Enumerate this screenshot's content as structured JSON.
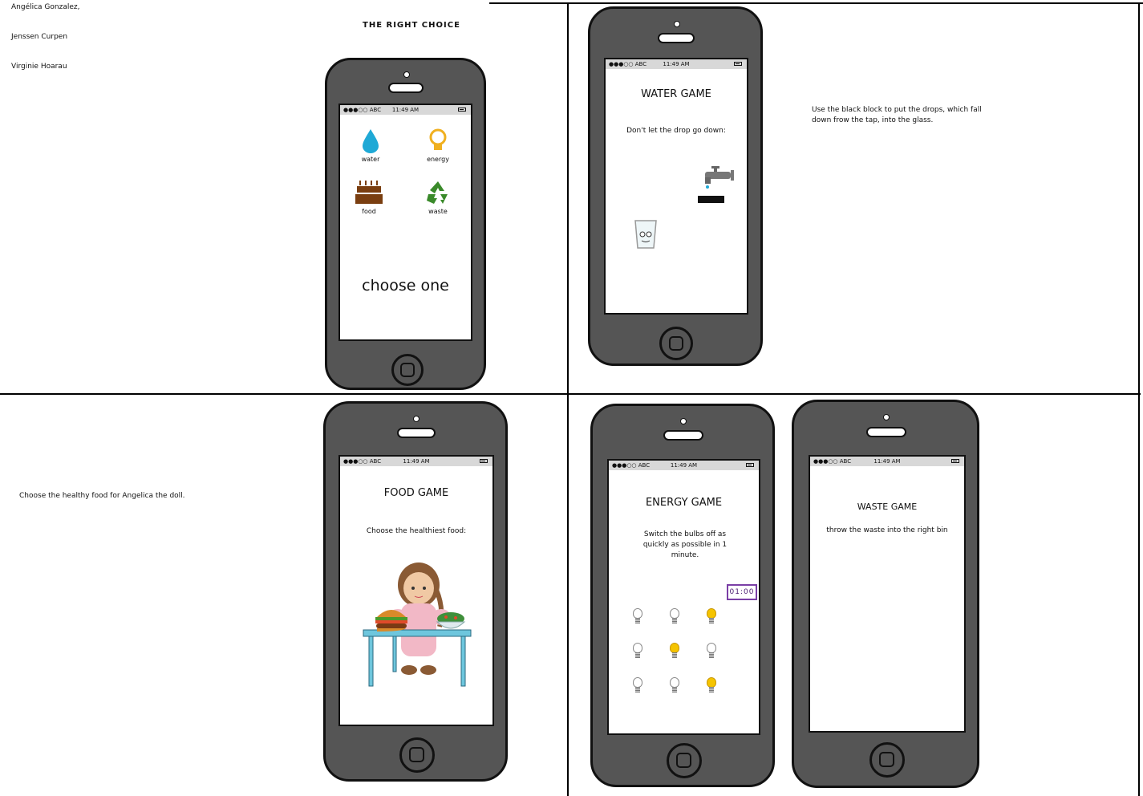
{
  "authors": [
    "Angélica Gonzalez,",
    "Jenssen Curpen",
    "Virginie Hoarau"
  ],
  "app_title": "THE RIGHT CHOICE",
  "status_bar": {
    "carrier": "●●●○○ ABC",
    "time": "11:49 AM"
  },
  "menu": {
    "categories": [
      {
        "label": "water",
        "icon": "water-drop-icon",
        "color": "#1fa9d6"
      },
      {
        "label": "energy",
        "icon": "lightbulb-icon",
        "color": "#f0b020"
      },
      {
        "label": "food",
        "icon": "cake-icon",
        "color": "#7a3e10"
      },
      {
        "label": "waste",
        "icon": "recycle-icon",
        "color": "#3a8a2a"
      }
    ],
    "prompt": "choose one"
  },
  "water_game": {
    "title": "WATER GAME",
    "instruction": "Don't let the drop go down:",
    "description": "Use the black block to put the drops, which fall down frow the tap,  into the glass."
  },
  "food_game": {
    "title": "FOOD GAME",
    "instruction": "Choose the healthiest food:",
    "description": "Choose the healthy food for Angelica the doll."
  },
  "energy_game": {
    "title": "ENERGY GAME",
    "instruction": "Switch the bulbs off as quickly as possible in 1 minute.",
    "timer": "01:00",
    "bulbs_on": [
      false,
      false,
      true,
      false,
      true,
      false,
      false,
      false,
      true
    ]
  },
  "waste_game": {
    "title": "WASTE GAME",
    "instruction": "throw the waste into the right bin"
  }
}
